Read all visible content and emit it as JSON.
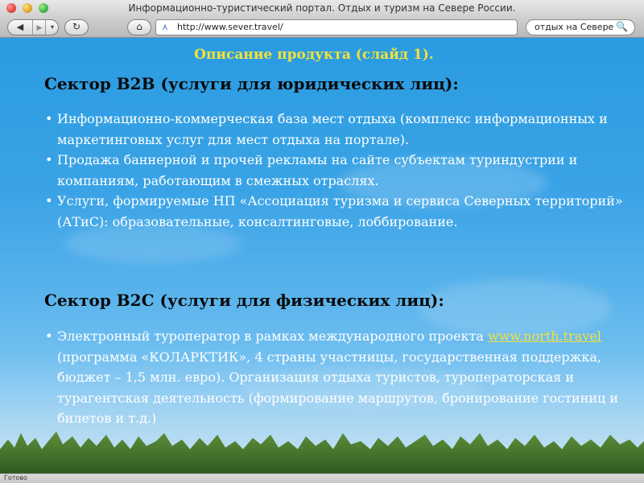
{
  "window": {
    "title": "Информационно-туристический портал. Отдых и туризм на Севере России."
  },
  "toolbar": {
    "back_icon": "◀",
    "forward_icon": "▶",
    "history_menu_icon": "▾",
    "reload_icon": "↻",
    "home_icon": "⌂",
    "favicon": "⋏",
    "url": "http://www.sever.travel/",
    "search_query": "отдых на Севере",
    "search_icon": "🔍"
  },
  "slide": {
    "title": "Описание продукта (слайд 1).",
    "sections": [
      {
        "heading": "Сектор B2B (услуги для юридических лиц):",
        "items": [
          "Информационно-коммерческая база мест отдыха (комплекс информационных и маркетинговых услуг для мест отдыха на портале).",
          "Продажа баннерной и прочей рекламы на сайте субъектам туриндустрии и компаниям, работающим в смежных отраслях.",
          "Услуги, формируемые  НП «Ассоциация туризма и сервиса Северных территорий» (АТиС): образовательные, консалтинговые, лоббирование."
        ]
      },
      {
        "heading": "Сектор B2C (услуги для физических лиц):",
        "items": [
          {
            "prefix": "Электронный туроператор в рамках международного проекта ",
            "link": "www.north.travel",
            "suffix": " (программа «КОЛАРКТИК», 4 страны участницы, государственная поддержка, бюджет – 1,5 млн. евро). Организация отдыха туристов, туроператорская и турагентская деятельность (формирование маршрутов, бронирование гостиниц и билетов и т.д.)"
          }
        ]
      }
    ]
  },
  "status": {
    "text": "Готово"
  },
  "colors": {
    "title_yellow": "#f3e23a",
    "sky_blue": "#2a9be1",
    "heading_text": "#0b0b0b",
    "body_text": "#ffffff"
  }
}
